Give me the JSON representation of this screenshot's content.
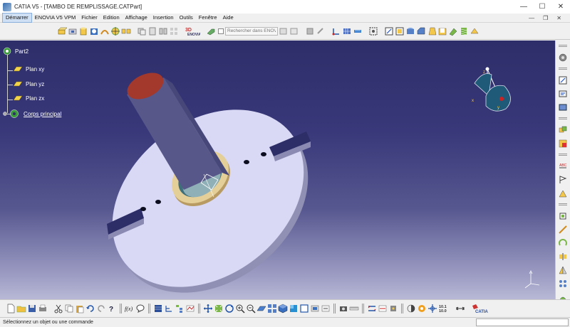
{
  "window": {
    "title": "CATIA V5 - [TAMBO DE REMPLISSAGE.CATPart]",
    "controls": {
      "minimize": "—",
      "maximize": "☐",
      "close": "✕"
    }
  },
  "menu": {
    "items": [
      "Démarrer",
      "ENOVIA V5 VPM",
      "Fichier",
      "Edition",
      "Affichage",
      "Insertion",
      "Outils",
      "Fenêtre",
      "Aide"
    ],
    "active_index": 0,
    "doc_controls": {
      "minimize": "—",
      "restore": "❐",
      "close": "✕"
    }
  },
  "toolbar_top": {
    "search_placeholder": "Rechercher dans ENOVIA"
  },
  "tree": {
    "root": "Part2",
    "children": [
      "Plan xy",
      "Plan yz",
      "Plan zx"
    ],
    "body": "Corps principal"
  },
  "compass": {
    "x_label": "x",
    "y_label": "y",
    "z_label": "z"
  },
  "status": {
    "message": "Sélectionnez un objet ou une commande"
  },
  "icons": {
    "titlebar": "catia-app-icon",
    "compass": "compass-icon",
    "axis_triad": "axis-triad-icon"
  },
  "colors": {
    "viewport_top": "#2e2e6a",
    "viewport_bottom": "#b8b8d6",
    "part_face": "#d8d8f4",
    "shaft_top": "#a0362c",
    "ring": "#d8c08a",
    "menu_active": "#cfe0f4"
  }
}
